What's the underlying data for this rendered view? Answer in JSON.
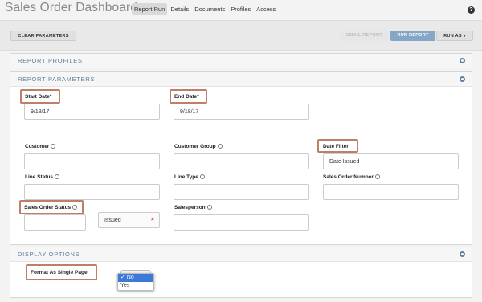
{
  "app": {
    "title": "Sales Order Dashboard"
  },
  "tabs": [
    {
      "label": "Report Run",
      "active": true
    },
    {
      "label": "Details",
      "active": false
    },
    {
      "label": "Documents",
      "active": false
    },
    {
      "label": "Profiles",
      "active": false
    },
    {
      "label": "Access",
      "active": false
    }
  ],
  "help_icon": "?",
  "toolbar": {
    "clear_label": "CLEAR PARAMETERS",
    "email_label": "EMAIL REPORT",
    "run_label": "RUN REPORT",
    "runas_label": "RUN AS ▾"
  },
  "panels": {
    "profiles_title": "REPORT PROFILES",
    "params_title": "REPORT PARAMETERS",
    "display_title": "DISPLAY OPTIONS"
  },
  "params": {
    "start_date_label": "Start Date*",
    "start_date_value": "9/18/17",
    "end_date_label": "End Date*",
    "end_date_value": "9/18/17",
    "customer_label": "Customer",
    "customer_group_label": "Customer Group",
    "date_filter_label": "Date Filter",
    "date_filter_value": "Date Issued",
    "line_status_label": "Line Status",
    "line_type_label": "Line Type",
    "sales_order_number_label": "Sales Order Number",
    "sales_order_status_label": "Sales Order Status",
    "sales_order_status_chip": "Issued",
    "chip_remove": "×",
    "salesperson_label": "Salesperson"
  },
  "display": {
    "single_page_label": "Format As Single Page:",
    "options": [
      "✓ No",
      "Yes"
    ],
    "selected": "No"
  },
  "colors": {
    "accent": "#5f7ea0",
    "run_button": "#86a6c8",
    "highlight": "#bf7f66",
    "selected_option": "#3d79d8"
  }
}
